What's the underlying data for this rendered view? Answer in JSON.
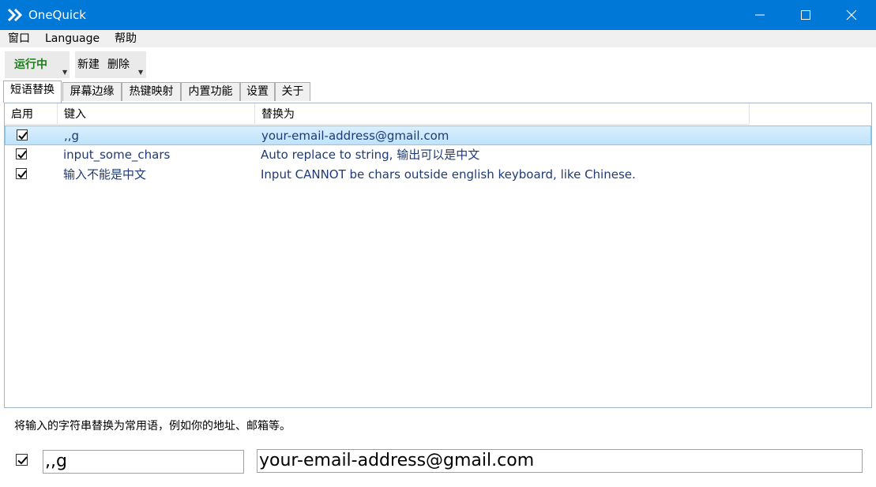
{
  "window": {
    "title": "OneQuick"
  },
  "menu": [
    "窗口",
    "Language",
    "帮助"
  ],
  "toolbar": {
    "status": "运行中",
    "new": "新建",
    "delete": "删除",
    "status_color": "#1a7f1a"
  },
  "tabs": [
    "短语替换",
    "屏幕边缘",
    "热键映射",
    "内置功能",
    "设置",
    "关于"
  ],
  "grid": {
    "headers": [
      "启用",
      "键入",
      "替换为"
    ],
    "rows": [
      {
        "enabled": true,
        "key": ",,g",
        "replace": "your-email-address@gmail.com"
      },
      {
        "enabled": true,
        "key": "input_some_chars",
        "replace": "Auto replace to string, 输出可以是中文"
      },
      {
        "enabled": true,
        "key": "输入不能是中文",
        "replace": "Input CANNOT be chars outside english keyboard, like Chinese."
      }
    ]
  },
  "description": "将输入的字符串替换为常用语，例如你的地址、邮箱等。",
  "editor": {
    "enabled": true,
    "key": ",,g",
    "value": "your-email-address@gmail.com"
  },
  "colors": {
    "titlebar": "#0078d7",
    "selection": "#cce8fb"
  }
}
